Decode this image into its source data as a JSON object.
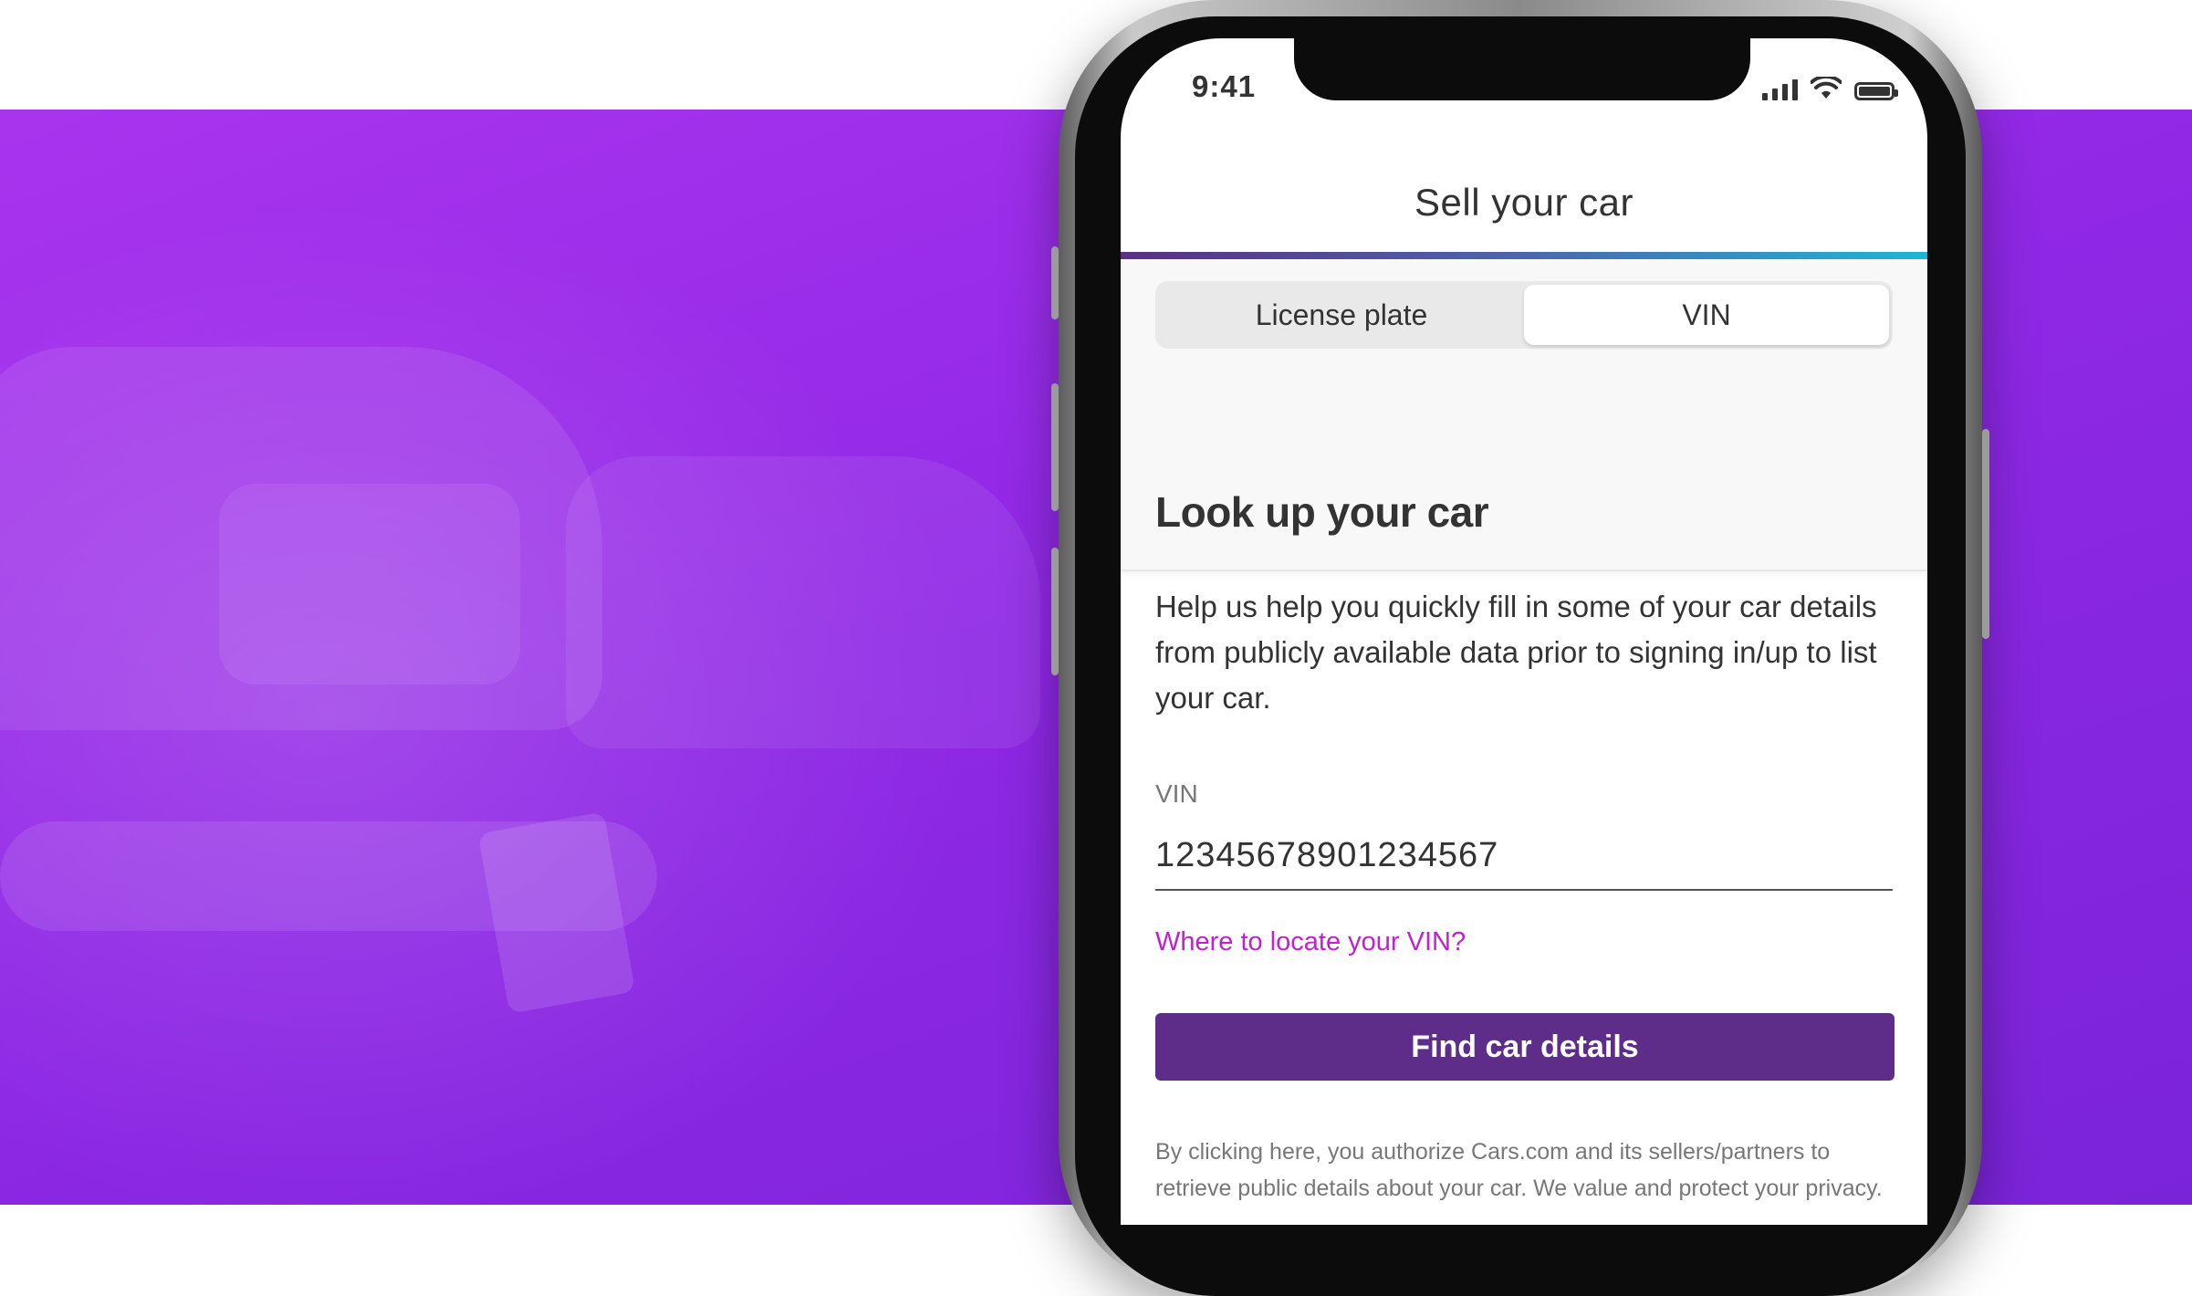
{
  "status_bar": {
    "time": "9:41"
  },
  "header": {
    "title": "Sell your car"
  },
  "lookup_type": {
    "options": [
      {
        "label": "License plate",
        "selected": false
      },
      {
        "label": "VIN",
        "selected": true
      }
    ]
  },
  "section": {
    "title": "Look up your car"
  },
  "description": "Help us help you quickly fill in some of your car details from publicly available data prior to signing in/up to list your car.",
  "vin_field": {
    "label": "VIN",
    "value": "12345678901234567",
    "help_link": "Where to locate your VIN?"
  },
  "submit": {
    "label": "Find car details"
  },
  "disclaimer": "By clicking here, you authorize Cars.com and its sellers/partners to retrieve public details about your car. We value and protect your privacy.",
  "colors": {
    "hero_purple": "#9a2fea",
    "button_purple": "#5e2c89",
    "link_magenta": "#c21fd1",
    "progress_start": "#5b2f86",
    "progress_end": "#1fb6d6"
  }
}
